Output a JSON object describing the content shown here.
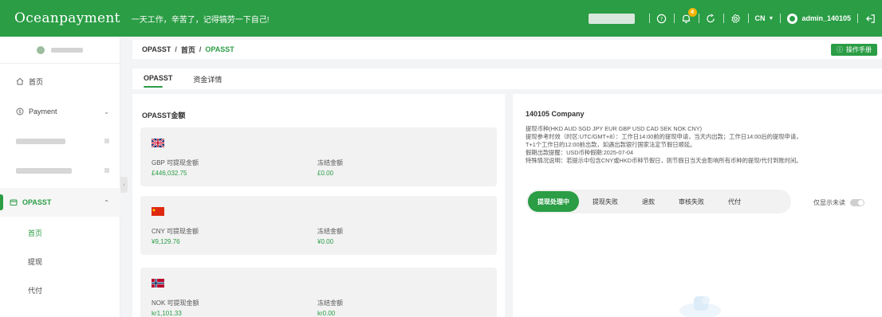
{
  "header": {
    "logo": "Oceanpayment",
    "slogan": "一天工作，辛苦了，记得犒劳一下自己!",
    "notification_count": "4",
    "language": "CN",
    "username": "admin_140105"
  },
  "sidebar": {
    "items": [
      {
        "label": "首页"
      },
      {
        "label": "Payment"
      },
      {
        "label": "OPASST"
      }
    ],
    "subitems": [
      {
        "label": "首页"
      },
      {
        "label": "提现"
      },
      {
        "label": "代付"
      }
    ]
  },
  "breadcrumb": {
    "root": "OPASST",
    "home": "首页",
    "current": "OPASST",
    "separator": "/"
  },
  "manual_button": "操作手册",
  "tabs": [
    {
      "label": "OPASST"
    },
    {
      "label": "资金详情"
    }
  ],
  "balance_panel": {
    "title": "OPASST金额",
    "cards": [
      {
        "currency": "GBP",
        "available_label": "GBP 可提现金额",
        "available": "£446,032.75",
        "frozen_label": "冻结金额",
        "frozen": "£0.00"
      },
      {
        "currency": "CNY",
        "available_label": "CNY 可提现金额",
        "available": "¥9,129.76",
        "frozen_label": "冻结金额",
        "frozen": "¥0.00"
      },
      {
        "currency": "NOK",
        "available_label": "NOK 可提现金额",
        "available": "kr1,101.33",
        "frozen_label": "冻结金额",
        "frozen": "kr0.00"
      }
    ]
  },
  "info_panel": {
    "company": "140105 Company",
    "lines": [
      "提现币种(HKD AUD SGD JPY EUR GBP USD CAD SEK NOK CNY)",
      "提现参考时效（时区:UTC/GMT+8）：工作日14:00前的提现申请，当天内出款；工作日14:00后的提现申请，",
      "T+1个工作日的12:00前出款，如遇出款银行国家法定节假日顺延。",
      "假期出款提醒：USD币种假期:2025-07-04",
      "特殊情况说明：若提示中包含CNY或HKD币种节假日，则节假日当天会影响所有币种的提现/代付到账时间。"
    ],
    "filters": [
      {
        "label": "提现处理中"
      },
      {
        "label": "提现失败"
      },
      {
        "label": "退款"
      },
      {
        "label": "审核失败"
      },
      {
        "label": "代付"
      }
    ],
    "unread_only_label": "仅显示未读"
  },
  "colors": {
    "brand": "#2a9d45"
  }
}
